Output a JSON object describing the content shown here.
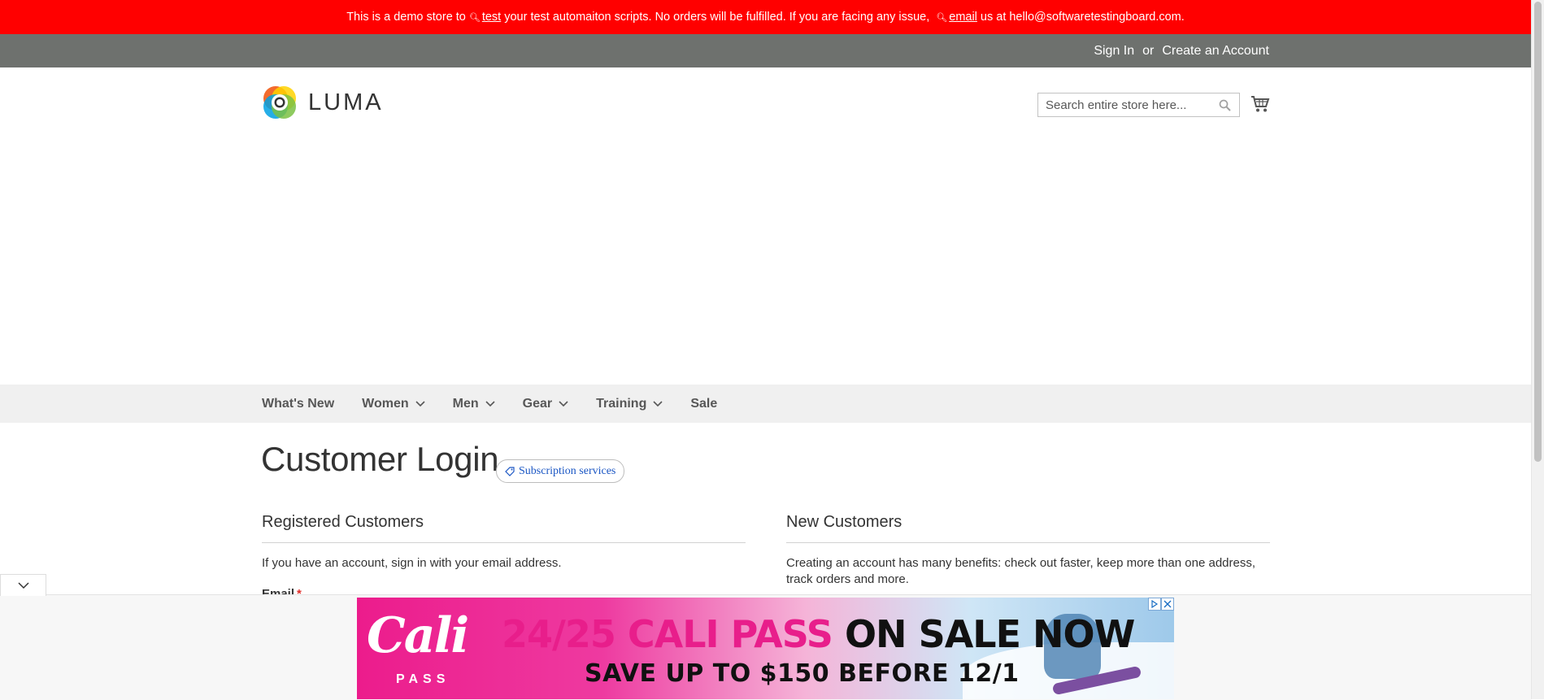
{
  "demo_notice": {
    "part1": "This is a demo store to",
    "link1": "test",
    "part2": "your test automaiton scripts. No orders will be fulfilled. If you are facing any issue,",
    "link2": "email",
    "part3": "us at hello@softwaretestingboard.com."
  },
  "header_links": {
    "sign_in": "Sign In",
    "or": "or",
    "create_account": "Create an Account"
  },
  "logo": {
    "text": "LUMA"
  },
  "search": {
    "placeholder": "Search entire store here..."
  },
  "nav": {
    "items": [
      {
        "label": "What's New",
        "has_dropdown": false
      },
      {
        "label": "Women",
        "has_dropdown": true
      },
      {
        "label": "Men",
        "has_dropdown": true
      },
      {
        "label": "Gear",
        "has_dropdown": true
      },
      {
        "label": "Training",
        "has_dropdown": true
      },
      {
        "label": "Sale",
        "has_dropdown": false
      }
    ]
  },
  "page": {
    "title": "Customer Login",
    "badge": "Subscription services"
  },
  "registered": {
    "title": "Registered Customers",
    "intro": "If you have an account, sign in with your email address.",
    "email_label": "Email",
    "required_mark": "*"
  },
  "new_customers": {
    "title": "New Customers",
    "intro": "Creating an account has many benefits: check out faster, keep more than one address, track orders and more."
  },
  "ad": {
    "brand": "Cali",
    "brand_sub": "PASS",
    "headline_pink": "24/25 CALI PASS",
    "headline_dark": "ON SALE NOW",
    "subline": "SAVE UP TO $150 BEFORE 12/1"
  },
  "colors": {
    "demo_bar": "#ff0000",
    "top_bar": "#6e716e",
    "nav_bg": "#f0f0f0",
    "badge_text": "#1a56c4"
  }
}
